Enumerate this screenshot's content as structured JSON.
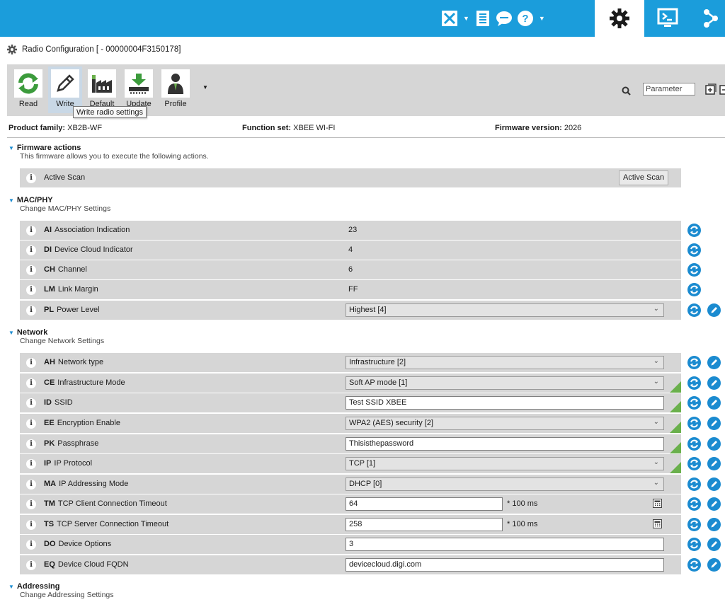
{
  "app": {
    "title": "Radio Configuration [ - 00000004F3150178]",
    "colors": {
      "accent": "#1b9ddb",
      "modified": "#6ab04c",
      "panel": "#d6d6d6"
    }
  },
  "topbar": {
    "icons": [
      "tools-icon",
      "list-icon",
      "chat-icon",
      "help-icon"
    ],
    "tabs": [
      "configuration-icon",
      "console-icon",
      "network-icon"
    ]
  },
  "toolbar": {
    "read_label": "Read",
    "write_label": "Write",
    "default_label": "Default",
    "update_label": "Update",
    "profile_label": "Profile",
    "search_placeholder": "Parameter",
    "tooltip": "Write radio settings"
  },
  "info": {
    "product_family_label": "Product family:",
    "product_family": "XB2B-WF",
    "function_set_label": "Function set:",
    "function_set": "XBEE WI-FI",
    "firmware_version_label": "Firmware version:",
    "firmware_version": "2026"
  },
  "sections": {
    "firmware_actions": {
      "title": "Firmware actions",
      "desc": "This firmware allows you to execute the following actions.",
      "row_label": "Active Scan",
      "button": "Active Scan"
    },
    "mac_phy": {
      "title": "MAC/PHY",
      "desc": "Change MAC/PHY Settings",
      "rows": [
        {
          "code": "AI",
          "name": "Association Indication",
          "value": "23"
        },
        {
          "code": "DI",
          "name": "Device Cloud Indicator",
          "value": "4"
        },
        {
          "code": "CH",
          "name": "Channel",
          "value": "6"
        },
        {
          "code": "LM",
          "name": "Link Margin",
          "value": "FF"
        },
        {
          "code": "PL",
          "name": "Power Level",
          "value": "Highest [4]"
        }
      ]
    },
    "network": {
      "title": "Network",
      "desc": "Change Network Settings",
      "rows": [
        {
          "code": "AH",
          "name": "Network type",
          "value": "Infrastructure [2]"
        },
        {
          "code": "CE",
          "name": "Infrastructure Mode",
          "value": "Soft AP mode [1]"
        },
        {
          "code": "ID",
          "name": "SSID",
          "value": "Test SSID XBEE"
        },
        {
          "code": "EE",
          "name": "Encryption Enable",
          "value": "WPA2 (AES) security [2]"
        },
        {
          "code": "PK",
          "name": "Passphrase",
          "value": "Thisisthepassword"
        },
        {
          "code": "IP",
          "name": "IP Protocol",
          "value": "TCP [1]"
        },
        {
          "code": "MA",
          "name": "IP Addressing Mode",
          "value": "DHCP [0]"
        },
        {
          "code": "TM",
          "name": "TCP Client Connection Timeout",
          "value": "64",
          "unit": "* 100 ms"
        },
        {
          "code": "TS",
          "name": "TCP Server Connection Timeout",
          "value": "258",
          "unit": "* 100 ms"
        },
        {
          "code": "DO",
          "name": "Device Options",
          "value": "3"
        },
        {
          "code": "EQ",
          "name": "Device Cloud FQDN",
          "value": "devicecloud.digi.com"
        }
      ]
    },
    "addressing": {
      "title": "Addressing",
      "desc": "Change Addressing Settings"
    }
  }
}
